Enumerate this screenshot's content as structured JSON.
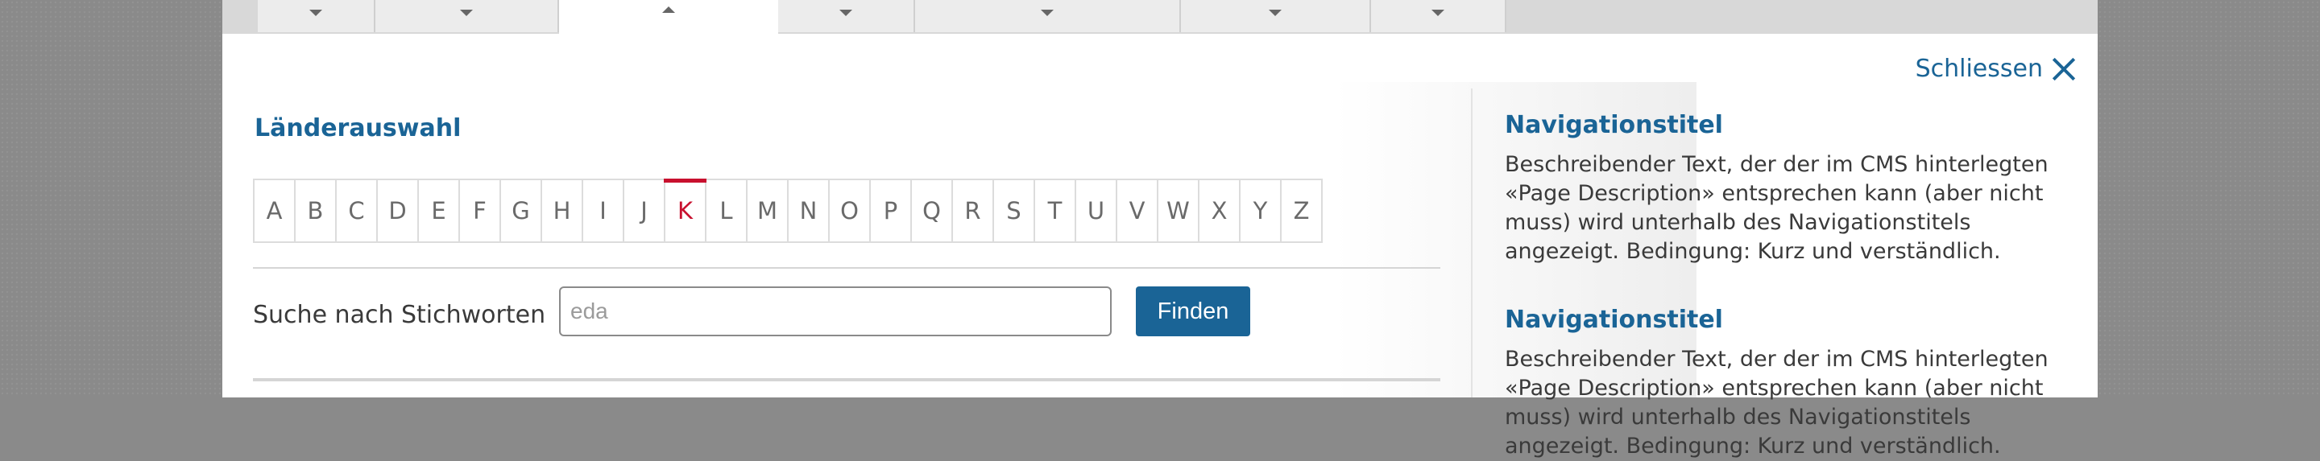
{
  "tabs": [
    {
      "id": 1,
      "active": false
    },
    {
      "id": 2,
      "active": false
    },
    {
      "id": 3,
      "active": true
    },
    {
      "id": 4,
      "active": false
    },
    {
      "id": 5,
      "active": false
    },
    {
      "id": 6,
      "active": false
    },
    {
      "id": 7,
      "active": false
    }
  ],
  "close_label": "Schliessen",
  "section_title": "Länderauswahl",
  "alphabet": [
    "A",
    "B",
    "C",
    "D",
    "E",
    "F",
    "G",
    "H",
    "I",
    "J",
    "K",
    "L",
    "M",
    "N",
    "O",
    "P",
    "Q",
    "R",
    "S",
    "T",
    "U",
    "V",
    "W",
    "X",
    "Y",
    "Z"
  ],
  "active_letter": "K",
  "search": {
    "label": "Suche nach Stichworten",
    "placeholder": "eda",
    "button_label": "Finden"
  },
  "nav_items": [
    {
      "title": "Navigationstitel",
      "description": "Beschreibender Text, der der im CMS hinterlegten «Page Description» entsprechen kann (aber nicht muss) wird unterhalb des Navigationstitels angezeigt. Bedingung: Kurz und verständlich."
    },
    {
      "title": "Navigationstitel",
      "description": "Beschreibender Text, der der im CMS hinterlegten «Page Description» entsprechen kann (aber nicht muss) wird unterhalb des Navigationstitels angezeigt. Bedingung: Kurz und verständlich."
    }
  ],
  "colors": {
    "accent": "#1a6496",
    "active_letter": "#c8102e",
    "backdrop": "#8a8a8a"
  }
}
